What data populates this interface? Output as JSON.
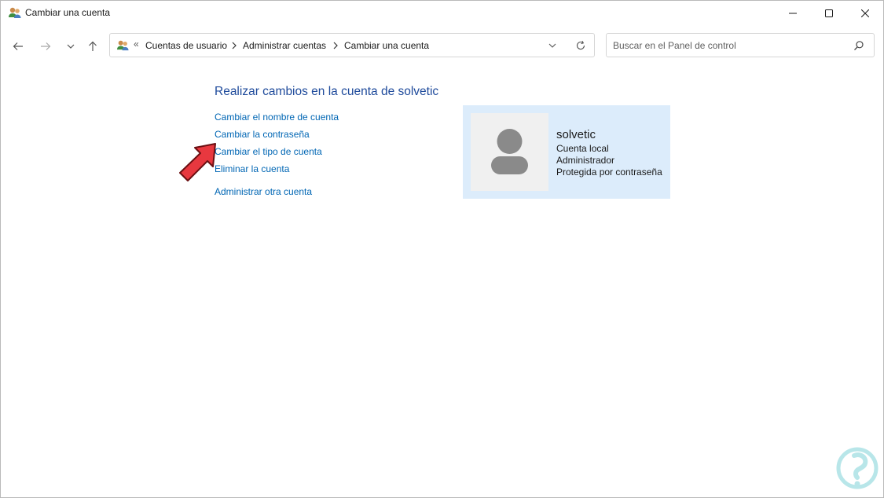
{
  "window": {
    "title": "Cambiar una cuenta"
  },
  "address_bar": {
    "overflow_glyph": "«",
    "breadcrumbs": [
      "Cuentas de usuario",
      "Administrar cuentas",
      "Cambiar una cuenta"
    ]
  },
  "search": {
    "placeholder": "Buscar en el Panel de control"
  },
  "main": {
    "heading": "Realizar cambios en la cuenta de solvetic",
    "links": [
      "Cambiar el nombre de cuenta",
      "Cambiar la contraseña",
      "Cambiar el tipo de cuenta",
      "Eliminar la cuenta",
      "Administrar otra cuenta"
    ]
  },
  "account": {
    "name": "solvetic",
    "type": "Cuenta local",
    "role": "Administrador",
    "protection": "Protegida por contraseña"
  },
  "colors": {
    "link": "#0066b4",
    "heading": "#1e4a9b",
    "card_bg": "#dcecfb",
    "arrow": "#e8383f"
  },
  "icons": {
    "title": "users-icon",
    "address": "users-icon",
    "back": "back-arrow-icon",
    "forward": "forward-arrow-icon",
    "recent": "chevron-down-icon",
    "up": "up-arrow-icon",
    "dropdown": "chevron-down-icon",
    "refresh": "refresh-icon",
    "search": "search-icon"
  }
}
